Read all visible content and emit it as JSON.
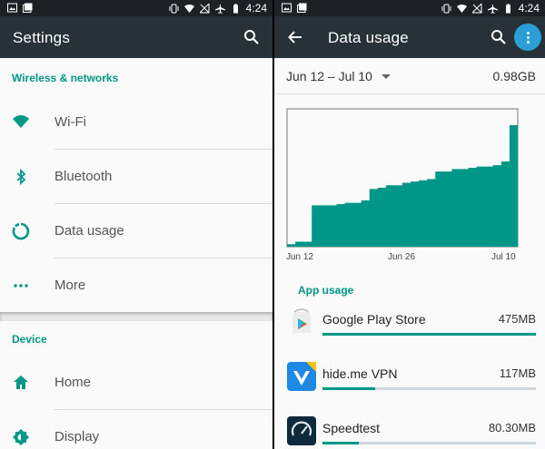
{
  "status_bar": {
    "time": "4:24"
  },
  "settings": {
    "title": "Settings",
    "sections": [
      {
        "header": "Wireless & networks",
        "items": [
          {
            "label": "Wi-Fi",
            "icon": "wifi-icon"
          },
          {
            "label": "Bluetooth",
            "icon": "bluetooth-icon"
          },
          {
            "label": "Data usage",
            "icon": "data-usage-icon"
          },
          {
            "label": "More",
            "icon": "more-icon"
          }
        ]
      },
      {
        "header": "Device",
        "items": [
          {
            "label": "Home",
            "icon": "home-icon"
          },
          {
            "label": "Display",
            "icon": "display-icon"
          }
        ]
      }
    ]
  },
  "data_usage": {
    "title": "Data usage",
    "period": "Jun 12 – Jul 10",
    "total": "0.98GB",
    "app_usage_header": "App usage",
    "apps": [
      {
        "name": "Google Play Store",
        "size": "475MB",
        "fraction": 1.0,
        "icon": "play-store-icon"
      },
      {
        "name": "hide.me VPN",
        "size": "117MB",
        "fraction": 0.246,
        "icon": "hideme-vpn-icon"
      },
      {
        "name": "Speedtest",
        "size": "80.30MB",
        "fraction": 0.169,
        "icon": "speedtest-icon"
      }
    ]
  },
  "colors": {
    "accent": "#009688",
    "appbar": "#263238",
    "statusbar": "#1d2125",
    "overflow_highlight": "#2a9fd6"
  },
  "chart_data": {
    "type": "area",
    "x_tick_labels": [
      "Jun 12",
      "Jun 26",
      "Jul 10"
    ],
    "x": [
      0,
      1,
      2,
      3,
      4,
      5,
      6,
      7,
      8,
      9,
      10,
      11,
      12,
      13,
      14,
      15,
      16,
      17,
      18,
      19,
      20,
      21,
      22,
      23,
      24,
      25,
      26,
      27,
      28
    ],
    "y": [
      0.02,
      0.04,
      0.04,
      0.33,
      0.33,
      0.33,
      0.34,
      0.35,
      0.35,
      0.37,
      0.46,
      0.47,
      0.49,
      0.49,
      0.51,
      0.52,
      0.53,
      0.54,
      0.6,
      0.6,
      0.62,
      0.62,
      0.63,
      0.64,
      0.64,
      0.65,
      0.68,
      0.97,
      0.98
    ],
    "ylim": [
      0,
      1.1
    ],
    "unit": "GB"
  }
}
